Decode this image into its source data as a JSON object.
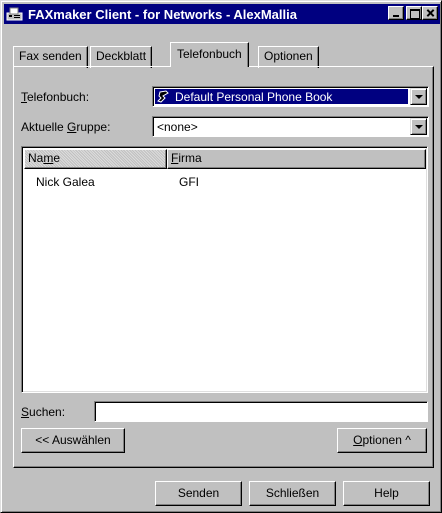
{
  "window": {
    "title": "FAXmaker Client - for Networks - AlexMallia",
    "app_icon": "faxmaker-app-icon",
    "controls": [
      "minimize-icon",
      "maximize-icon",
      "close-icon"
    ]
  },
  "tabs": [
    {
      "label": "Fax senden",
      "active": false
    },
    {
      "label": "Deckblatt",
      "active": false
    },
    {
      "label": "Telefonbuch",
      "active": true
    },
    {
      "label": "Optionen",
      "active": false
    }
  ],
  "phonebook": {
    "label_mnemonic": "T",
    "label_rest": "elefonbuch:",
    "selected": "Default Personal Phone Book",
    "selected_icon": "phonebook-icon"
  },
  "group": {
    "label_pre": "Aktuelle ",
    "label_mnemonic": "G",
    "label_post": "ruppe:",
    "selected": "<none>"
  },
  "list": {
    "columns": [
      {
        "pre": "Na",
        "mnemonic": "m",
        "post": "e"
      },
      {
        "pre": "",
        "mnemonic": "F",
        "post": "irma"
      }
    ],
    "rows": [
      {
        "name": "Nick Galea",
        "company": "GFI"
      }
    ]
  },
  "search": {
    "label_mnemonic": "S",
    "label_rest": "uchen:",
    "value": ""
  },
  "select_button": "<< Auswählen",
  "options_button": {
    "mnemonic": "O",
    "rest": "ptionen ^"
  },
  "footer": {
    "send": "Senden",
    "close": "Schließen",
    "help": "Help"
  }
}
